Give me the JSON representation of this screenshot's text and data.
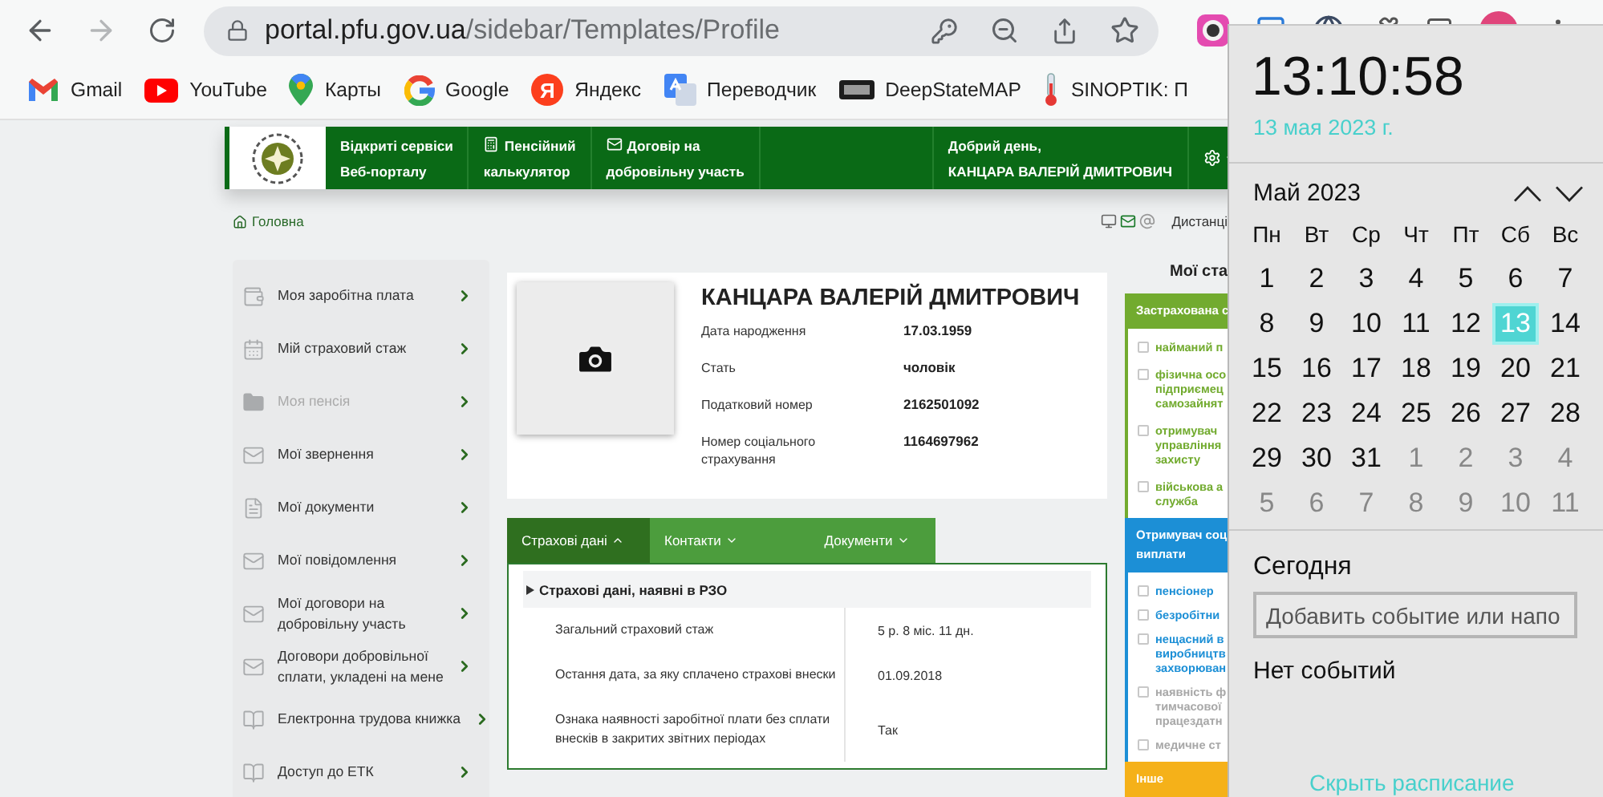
{
  "browser": {
    "nav_buttons": [
      {
        "kind": "back",
        "disabled": false
      },
      {
        "kind": "forward",
        "disabled": true
      },
      {
        "kind": "reload",
        "disabled": false
      }
    ],
    "address": {
      "host": "portal.pfu.gov.ua",
      "path": "/sidebar/Templates/Profile"
    },
    "bookmarks": [
      {
        "kind": "gmail",
        "label": "Gmail"
      },
      {
        "kind": "youtube",
        "label": "YouTube"
      },
      {
        "kind": "maps",
        "label": "Карты"
      },
      {
        "kind": "google",
        "label": "Google"
      },
      {
        "kind": "yandex",
        "label": "Яндекс",
        "mark": "Я"
      },
      {
        "kind": "translate",
        "label": "Переводчик"
      },
      {
        "kind": "deepstate",
        "label": "DeepStateMAP"
      },
      {
        "kind": "thermometer",
        "label": "SINOPTIK: П"
      }
    ]
  },
  "site_header": {
    "brand_lines": [
      "Відкриті сервіси",
      "Веб-порталу"
    ],
    "links": [
      {
        "kind": "calculator",
        "lines": [
          "Пенсійний",
          "калькулятор"
        ]
      },
      {
        "kind": "envelope",
        "lines": [
          "Договір на",
          "добровільну участь"
        ]
      }
    ],
    "greeting_lines": [
      "Добрий день,",
      "КАНЦАРА ВАЛЕРІЙ ДМИТРОВИЧ"
    ]
  },
  "breadcrumb": {
    "label": "Головна"
  },
  "page_tools": {
    "label": "Дистанці"
  },
  "sidebar": {
    "items": [
      {
        "kind": "wallet",
        "lines": [
          "Моя заробітна плата"
        ],
        "disabled": false
      },
      {
        "kind": "calendar",
        "lines": [
          "Мій страховий стаж"
        ],
        "disabled": false
      },
      {
        "kind": "folder",
        "lines": [
          "Моя пенсія"
        ],
        "disabled": true
      },
      {
        "kind": "mail",
        "lines": [
          "Мої звернення"
        ],
        "disabled": false
      },
      {
        "kind": "document",
        "lines": [
          "Мої документи"
        ],
        "disabled": false
      },
      {
        "kind": "mail",
        "lines": [
          "Мої повідомлення"
        ],
        "disabled": false
      },
      {
        "kind": "mail",
        "lines": [
          "Мої договори на",
          "добровільну участь"
        ],
        "disabled": false
      },
      {
        "kind": "mail",
        "lines": [
          "Договори добровільної",
          "сплати, укладені на мене"
        ],
        "disabled": false
      },
      {
        "kind": "book",
        "lines": [
          "Електронна трудова книжка"
        ],
        "disabled": false
      },
      {
        "kind": "book",
        "lines": [
          "Доступ до ЕТК"
        ],
        "disabled": false
      }
    ]
  },
  "profile": {
    "name": "КАНЦАРА ВАЛЕРІЙ ДМИТРОВИЧ",
    "fields": [
      {
        "label_lines": [
          "Дата народження"
        ],
        "value": "17.03.1959"
      },
      {
        "label_lines": [
          "Стать"
        ],
        "value": "чоловік"
      },
      {
        "label_lines": [
          "Податковий номер"
        ],
        "value": "2162501092"
      },
      {
        "label_lines": [
          "Номер соціального",
          "страхування"
        ],
        "value": "1164697962"
      }
    ]
  },
  "tabs": [
    {
      "label": "Страхові дані",
      "selected": true
    },
    {
      "label": "Контакти",
      "selected": false
    },
    {
      "label": "Документи",
      "selected": false
    }
  ],
  "insurance": {
    "title": "Страхові дані, наявні в РЗО",
    "rows": [
      {
        "label_lines": [
          "Загальний страховий стаж"
        ],
        "value": "5 р. 8 міс. 11 дн."
      },
      {
        "label_lines": [
          "Остання дата, за яку сплачено страхові внески"
        ],
        "value": "01.09.2018"
      },
      {
        "label_lines": [
          "Ознака наявності заробітної плати без сплати",
          "внесків в закритих звітних періодах"
        ],
        "value": "Так"
      }
    ]
  },
  "status": {
    "title": "Мої ста",
    "groups": [
      {
        "title_lines": [
          "Застрахована с"
        ],
        "color": "#72ab2f",
        "items": [
          {
            "lines": [
              "найманий п"
            ],
            "checked": false,
            "disabled": false
          },
          {
            "lines": [
              "фізична осо",
              "підприємец",
              "самозайнят"
            ],
            "checked": false,
            "disabled": false
          },
          {
            "lines": [
              "отримувач",
              "управління",
              "захисту"
            ],
            "checked": false,
            "disabled": false
          },
          {
            "lines": [
              "військова а",
              "служба"
            ],
            "checked": false,
            "disabled": false
          }
        ]
      },
      {
        "title_lines": [
          "Отримувач соц",
          "виплати"
        ],
        "color": "#1c8fd6",
        "items": [
          {
            "lines": [
              "пенсіонер"
            ],
            "checked": false,
            "disabled": false
          },
          {
            "lines": [
              "безробітни"
            ],
            "checked": false,
            "disabled": false
          },
          {
            "lines": [
              "нещасний в",
              "виробництв",
              "захворюван"
            ],
            "checked": false,
            "disabled": false
          },
          {
            "lines": [
              "наявність ф",
              "тимчасової",
              "працездатн"
            ],
            "checked": false,
            "disabled": true
          },
          {
            "lines": [
              "медичне ст"
            ],
            "checked": false,
            "disabled": true
          }
        ]
      },
      {
        "title_lines": [
          "Інше"
        ],
        "color": "#f5b119"
      }
    ]
  },
  "calendar": {
    "time": "13:10:58",
    "date": "13 мая 2023 г.",
    "month": "Май 2023",
    "weekdays": [
      "Пн",
      "Вт",
      "Ср",
      "Чт",
      "Пт",
      "Сб",
      "Вс"
    ],
    "days": [
      {
        "day": "1",
        "other_month": false,
        "selected": false
      },
      {
        "day": "2",
        "other_month": false,
        "selected": false
      },
      {
        "day": "3",
        "other_month": false,
        "selected": false
      },
      {
        "day": "4",
        "other_month": false,
        "selected": false
      },
      {
        "day": "5",
        "other_month": false,
        "selected": false
      },
      {
        "day": "6",
        "other_month": false,
        "selected": false
      },
      {
        "day": "7",
        "other_month": false,
        "selected": false
      },
      {
        "day": "8",
        "other_month": false,
        "selected": false
      },
      {
        "day": "9",
        "other_month": false,
        "selected": false
      },
      {
        "day": "10",
        "other_month": false,
        "selected": false
      },
      {
        "day": "11",
        "other_month": false,
        "selected": false
      },
      {
        "day": "12",
        "other_month": false,
        "selected": false
      },
      {
        "day": "13",
        "other_month": false,
        "selected": true
      },
      {
        "day": "14",
        "other_month": false,
        "selected": false
      },
      {
        "day": "15",
        "other_month": false,
        "selected": false
      },
      {
        "day": "16",
        "other_month": false,
        "selected": false
      },
      {
        "day": "17",
        "other_month": false,
        "selected": false
      },
      {
        "day": "18",
        "other_month": false,
        "selected": false
      },
      {
        "day": "19",
        "other_month": false,
        "selected": false
      },
      {
        "day": "20",
        "other_month": false,
        "selected": false
      },
      {
        "day": "21",
        "other_month": false,
        "selected": false
      },
      {
        "day": "22",
        "other_month": false,
        "selected": false
      },
      {
        "day": "23",
        "other_month": false,
        "selected": false
      },
      {
        "day": "24",
        "other_month": false,
        "selected": false
      },
      {
        "day": "25",
        "other_month": false,
        "selected": false
      },
      {
        "day": "26",
        "other_month": false,
        "selected": false
      },
      {
        "day": "27",
        "other_month": false,
        "selected": false
      },
      {
        "day": "28",
        "other_month": false,
        "selected": false
      },
      {
        "day": "29",
        "other_month": false,
        "selected": false
      },
      {
        "day": "30",
        "other_month": false,
        "selected": false
      },
      {
        "day": "31",
        "other_month": false,
        "selected": false
      },
      {
        "day": "1",
        "other_month": true,
        "selected": false
      },
      {
        "day": "2",
        "other_month": true,
        "selected": false
      },
      {
        "day": "3",
        "other_month": true,
        "selected": false
      },
      {
        "day": "4",
        "other_month": true,
        "selected": false
      },
      {
        "day": "5",
        "other_month": true,
        "selected": false
      },
      {
        "day": "6",
        "other_month": true,
        "selected": false
      },
      {
        "day": "7",
        "other_month": true,
        "selected": false
      },
      {
        "day": "8",
        "other_month": true,
        "selected": false
      },
      {
        "day": "9",
        "other_month": true,
        "selected": false
      },
      {
        "day": "10",
        "other_month": true,
        "selected": false
      },
      {
        "day": "11",
        "other_month": true,
        "selected": false
      }
    ],
    "today_label": "Сегодня",
    "event_placeholder": "Добавить событие или напо",
    "no_events": "Нет событий",
    "hide_link": "Скрыть расписание"
  }
}
